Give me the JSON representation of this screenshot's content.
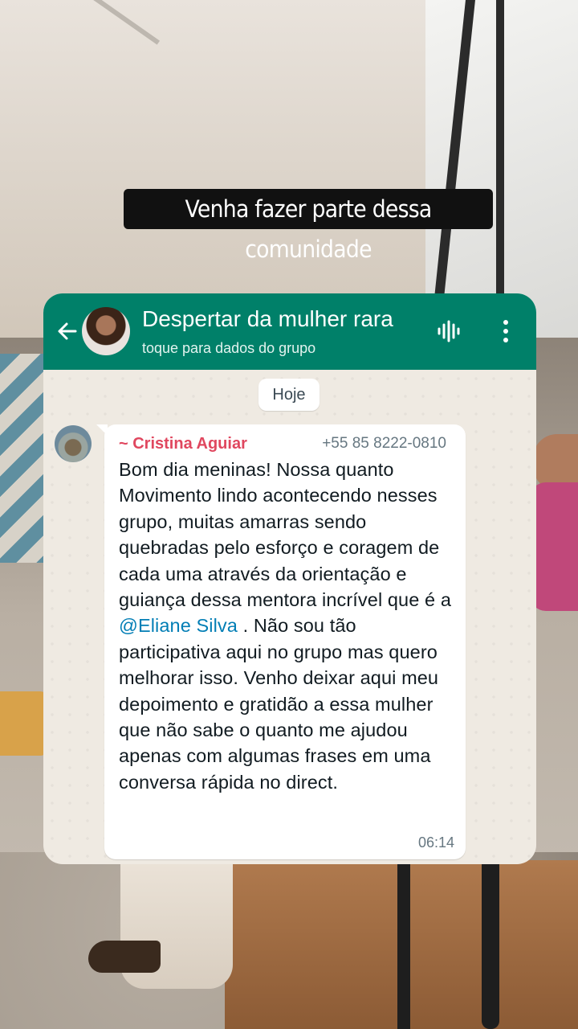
{
  "story": {
    "caption": "Venha fazer parte dessa comunidade"
  },
  "chat": {
    "header": {
      "title": "Despertar da mulher rara",
      "subtitle": "toque para dados do grupo",
      "icons": [
        "back-arrow-icon",
        "voice-call-icon",
        "more-options-icon"
      ]
    },
    "day_label": "Hoje",
    "message": {
      "sender": "~ Cristina Aguiar",
      "phone": "+55 85 8222-0810",
      "text_before": "Bom dia meninas! Nossa quanto Movimento lindo acontecendo nesses grupo, muitas amarras sendo quebradas pelo esforço e coragem de cada uma através da orientação e guiança dessa mentora incrível que é a ",
      "mention": "@Eliane Silva",
      "text_after": " . Não sou tão participativa aqui no grupo mas quero melhorar isso. Venho deixar aqui meu depoimento e gratidão a essa mulher que não sabe o quanto me ajudou apenas com algumas frases em uma conversa rápida no direct.",
      "time": "06:14"
    }
  },
  "colors": {
    "header": "#008069",
    "sender_name": "#e0475f",
    "mention": "#027eb5",
    "chat_background": "#efeae2"
  }
}
